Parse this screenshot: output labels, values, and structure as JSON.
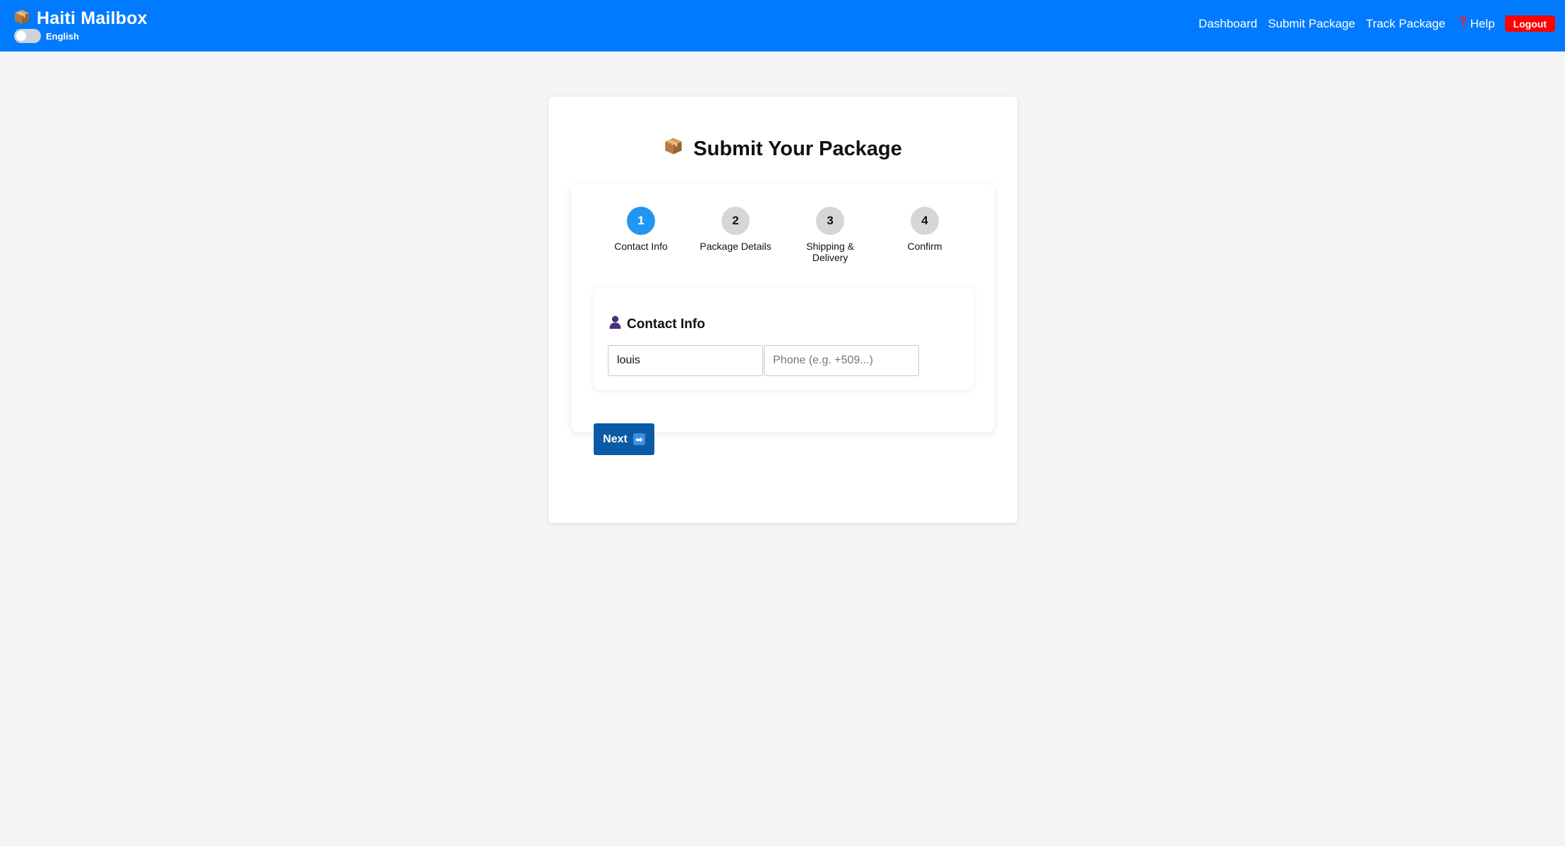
{
  "header": {
    "brand_icon": "package-icon",
    "brand_title": "Haiti Mailbox",
    "language_label": "English",
    "nav": {
      "dashboard": "Dashboard",
      "submit_package": "Submit Package",
      "track_package": "Track Package",
      "help": "Help",
      "logout": "Logout"
    },
    "help_icon": "question-mark-icon"
  },
  "colors": {
    "header_bg": "#007bff",
    "logout_bg": "#ff0000",
    "active_step": "#2196f3",
    "next_button": "#0b5aa6"
  },
  "page": {
    "title_icon": "package-icon",
    "title": "Submit Your Package"
  },
  "steps": [
    {
      "number": "1",
      "label": "Contact Info",
      "active": true
    },
    {
      "number": "2",
      "label": "Package Details",
      "active": false
    },
    {
      "number": "3",
      "label": "Shipping & Delivery",
      "active": false
    },
    {
      "number": "4",
      "label": "Confirm",
      "active": false
    }
  ],
  "contact_section": {
    "icon": "person-icon",
    "title": "Contact Info",
    "name_value": "louis",
    "phone_placeholder": "Phone (e.g. +509...)"
  },
  "actions": {
    "next_label": "Next",
    "next_icon": "right-arrow-icon"
  }
}
